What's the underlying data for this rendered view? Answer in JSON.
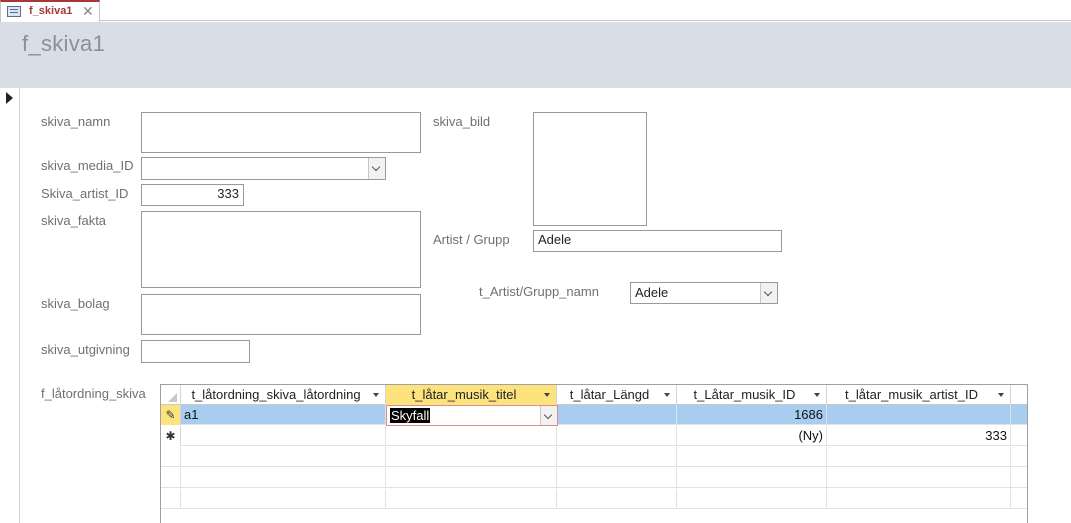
{
  "tab": {
    "label": "f_skiva1",
    "icon": "form-icon",
    "close_icon": "close-icon"
  },
  "form": {
    "title": "f_skiva1"
  },
  "fields": {
    "skiva_namn": {
      "label": "skiva_namn",
      "value": ""
    },
    "skiva_media_id": {
      "label": "skiva_media_ID",
      "value": ""
    },
    "skiva_artist_id": {
      "label": "Skiva_artist_ID",
      "value": "333"
    },
    "skiva_fakta": {
      "label": "skiva_fakta",
      "value": ""
    },
    "skiva_bolag": {
      "label": "skiva_bolag",
      "value": ""
    },
    "skiva_utgivning": {
      "label": "skiva_utgivning",
      "value": ""
    },
    "skiva_bild": {
      "label": "skiva_bild"
    },
    "artist_grupp": {
      "label": "Artist / Grupp",
      "value": "Adele"
    },
    "t_artist_grupp_namn": {
      "label": "t_Artist/Grupp_namn",
      "value": "Adele"
    }
  },
  "subform": {
    "label": "f_låtordning_skiva",
    "columns": [
      {
        "label": "t_låtordning_skiva_låtordning"
      },
      {
        "label": "t_låtar_musik_titel"
      },
      {
        "label": "t_låtar_Längd"
      },
      {
        "label": "t_Låtar_musik_ID"
      },
      {
        "label": "t_låtar_musik_artist_ID"
      }
    ],
    "rows": [
      {
        "selector": "✎",
        "ordning": "a1",
        "titel": "Skyfall",
        "langd": "",
        "musik_id": "1686",
        "artist_id": ""
      },
      {
        "selector": "✱",
        "ordning": "",
        "titel": "",
        "langd": "",
        "musik_id": "(Ny)",
        "artist_id": "333"
      }
    ]
  },
  "colors": {
    "header_band": "#d8dde6",
    "tab_accent": "#a4373a",
    "selected_row": "#a8cdf0",
    "active_header": "#fde37d"
  }
}
